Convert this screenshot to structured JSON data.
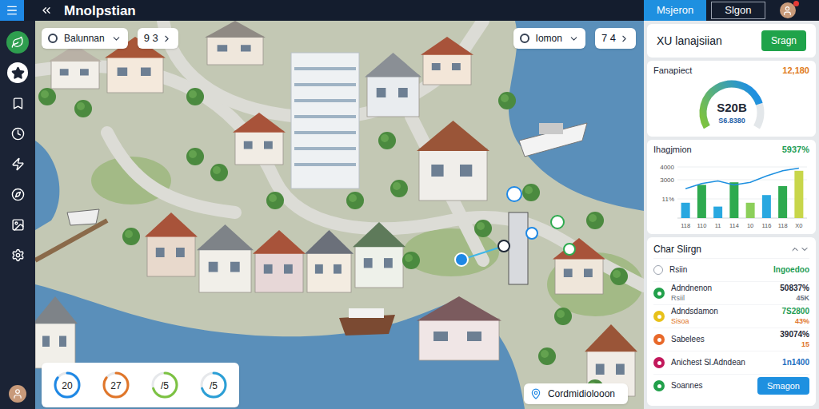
{
  "topbar": {
    "title": "Mnolpstian"
  },
  "header_tabs": [
    {
      "label": "Msjeron",
      "selected": true
    },
    {
      "label": "Slgon",
      "selected": false
    }
  ],
  "user": {
    "notification": true
  },
  "sidebar": {
    "items": [
      {
        "kind": "logo",
        "selected": false
      },
      {
        "kind": "star",
        "selected": true
      },
      {
        "kind": "bookmark",
        "selected": false
      },
      {
        "kind": "clock",
        "selected": false
      },
      {
        "kind": "bolt",
        "selected": false
      },
      {
        "kind": "compass",
        "selected": false
      },
      {
        "kind": "image",
        "selected": false
      },
      {
        "kind": "settings",
        "selected": false
      }
    ]
  },
  "map": {
    "filters": [
      {
        "label": "Balunnan",
        "value": "9 3"
      },
      {
        "label": "Iomon",
        "value": "7 4"
      }
    ],
    "gauges": [
      {
        "value": "20",
        "level": 0.85,
        "color": "#1e88e5"
      },
      {
        "value": "27",
        "level": 0.85,
        "color": "#e0762a"
      },
      {
        "value": "/5",
        "level": 0.7,
        "color": "#7cc242"
      },
      {
        "value": "/5",
        "level": 0.7,
        "color": "#2b9fd6"
      }
    ],
    "location": "Cordmidiolooon"
  },
  "panel": {
    "project": {
      "title": "XU lanajsiian",
      "button": "Sragn"
    },
    "budget": {
      "title": "Fanapiect",
      "value": "12,180",
      "main": "S20B",
      "sub": "S6.8380",
      "level": 0.8
    },
    "chart": {
      "title": "Ihagjmion",
      "change": "5937%",
      "ticks": [
        {
          "label": "4000",
          "value": 4000
        },
        {
          "label": "3000",
          "value": 3000
        },
        {
          "label": "11%",
          "value": 1500
        }
      ],
      "x_labels": [
        "118",
        "110",
        "11",
        "114",
        "10",
        "116",
        "118",
        "X0"
      ],
      "bars": [
        {
          "value": 1200,
          "color": "#29a8e0"
        },
        {
          "value": 2600,
          "color": "#2eaa4f"
        },
        {
          "value": 900,
          "color": "#29a8e0"
        },
        {
          "value": 2800,
          "color": "#2eaa4f"
        },
        {
          "value": 1200,
          "color": "#8ccf5a"
        },
        {
          "value": 1800,
          "color": "#29a8e0"
        },
        {
          "value": 2500,
          "color": "#2eaa4f"
        },
        {
          "value": 3700,
          "color": "#c8d64a"
        }
      ],
      "line": [
        2300,
        2700,
        2900,
        2600,
        2800,
        3300,
        3700,
        3900
      ]
    },
    "list": {
      "title": "Char Slirgn",
      "rows": [
        {
          "kind": "radio",
          "name": "Rsiin",
          "sub": "",
          "value": "Ingoedoo",
          "sub_value": "",
          "color": "#9ca3af",
          "value_color": "#1f9d55",
          "sub_color": "#6b7280"
        },
        {
          "kind": "dot",
          "name": "Adndnenon",
          "sub": "Rsiil",
          "value": "50837%",
          "sub_value": "45K",
          "color": "#22a04b",
          "value_color": "#1f2937",
          "sub_color": "#6b7280"
        },
        {
          "kind": "dot",
          "name": "Adndsdamon",
          "sub": "Sisoa",
          "value": "7S2800",
          "sub_value": "43%",
          "color": "#e8c11a",
          "value_color": "#1f9d55",
          "sub_color": "#e0762a"
        },
        {
          "kind": "dot",
          "name": "Sabelees",
          "sub": "",
          "value": "39074%",
          "sub_value": "15",
          "color": "#e8692a",
          "value_color": "#1f2937",
          "sub_color": "#e0762a"
        },
        {
          "kind": "dot",
          "name": "Anichest Sl.Adndean",
          "sub": "",
          "value": "1n1400",
          "sub_value": "",
          "color": "#c2185b",
          "value_color": "#1e6fbf",
          "sub_color": "#6b7280"
        },
        {
          "kind": "action",
          "name": "Soannes",
          "sub": "",
          "value": "Smagon",
          "sub_value": "",
          "color": "#22a04b",
          "value_color": "#ffffff",
          "sub_color": "#6b7280"
        }
      ]
    }
  }
}
